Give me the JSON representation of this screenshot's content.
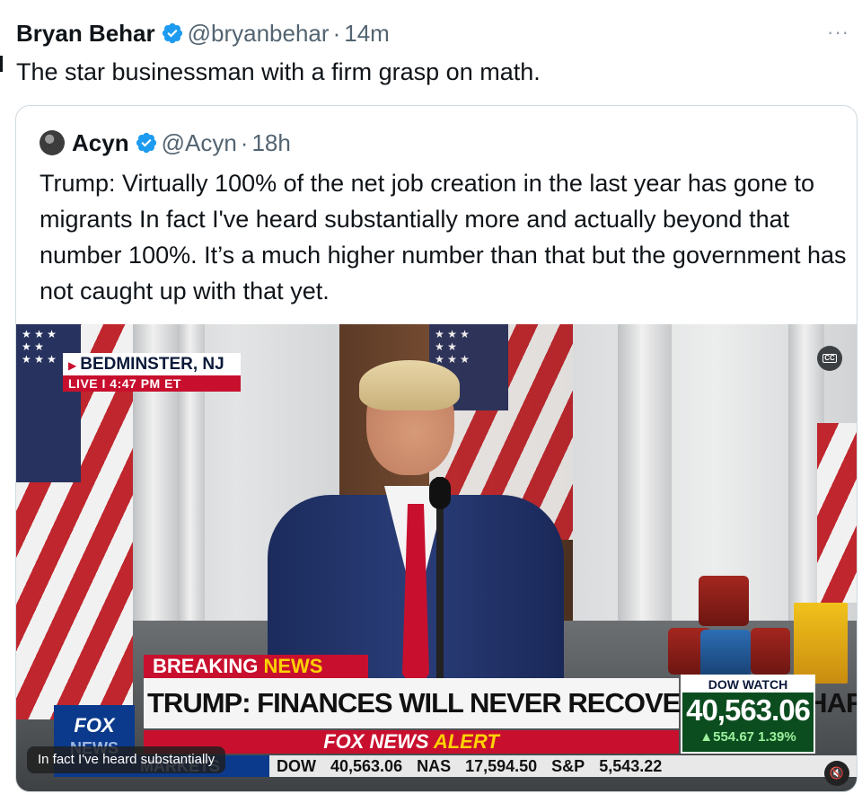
{
  "tweet": {
    "author_name": "Bryan Behar",
    "handle": "@bryanbehar",
    "separator": "·",
    "time": "14m",
    "more_label": "···",
    "text": "The star businessman with a firm grasp on math."
  },
  "quote": {
    "author_name": "Acyn",
    "handle": "@Acyn",
    "separator": "·",
    "time": "18h",
    "text": "Trump: Virtually 100% of the net job creation in the last year has gone to migrants In fact I've heard substantially more and actually beyond that number 100%. It’s a much higher number than that but the government has not caught up with that yet."
  },
  "video": {
    "cc_label": "CC",
    "location": "BEDMINSTER, NJ",
    "live_label": "LIVE  I  4:47 PM ET",
    "breaking_label": "BREAKING",
    "news_label": "NEWS",
    "headline": "TRUMP: FINANCES WILL NEVER RECOVER UNDER HARRIS",
    "alert_prefix": "FOX NEWS",
    "alert_word": "ALERT",
    "logo_line1": "FOX",
    "logo_line2": "NEWS",
    "dow_watch_label": "DOW WATCH",
    "dow_value": "40,563.06",
    "dow_change": "▲554.67 1.39%",
    "ticker": {
      "markets_label": "MARKETS",
      "dow_label": "DOW",
      "dow_value": "40,563.06",
      "nas_label": "NAS",
      "nas_value": "17,594.50",
      "sp_label": "S&P",
      "sp_value": "5,543.22"
    },
    "caption": "In fact I've heard substantially",
    "mute_icon": "🔇"
  },
  "colors": {
    "verified_blue": "#1d9bf0",
    "fox_red": "#c8102e",
    "fox_blue": "#0b3a8c",
    "dow_green": "#0b4d1f"
  }
}
